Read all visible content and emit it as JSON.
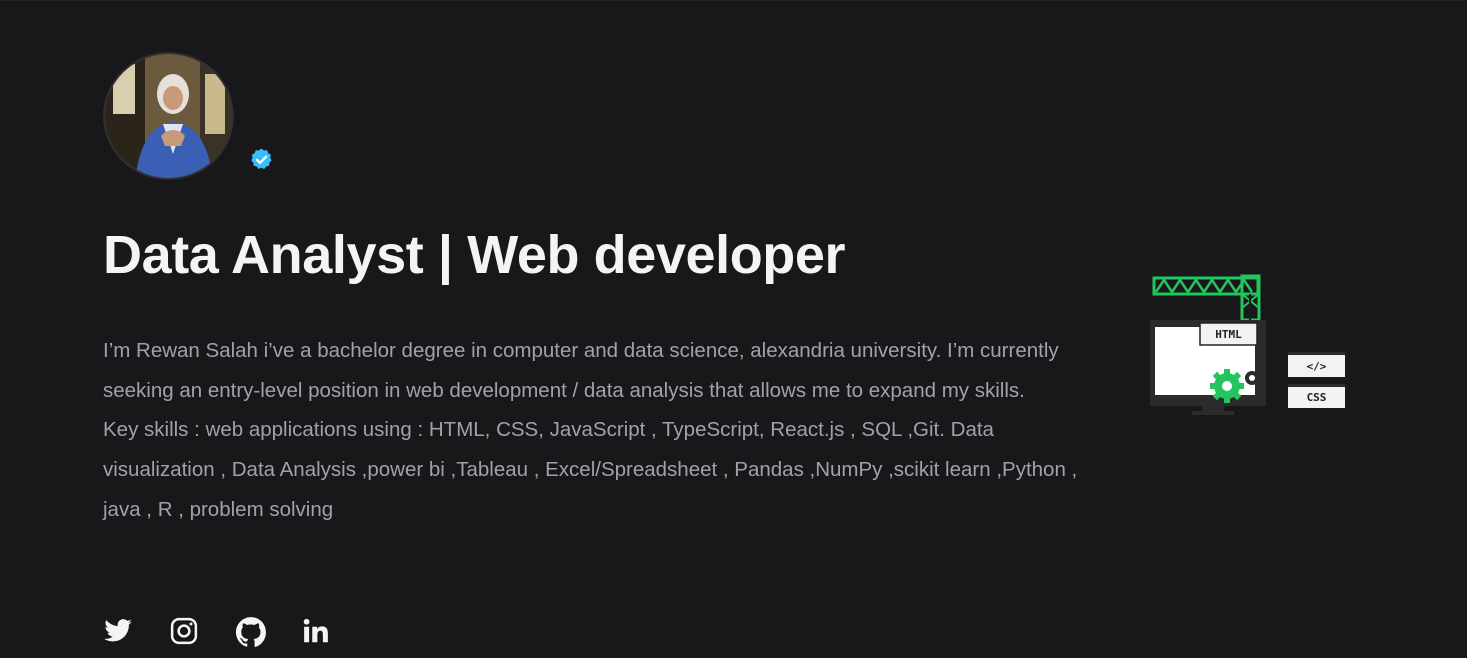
{
  "profile": {
    "avatar_alt": "Profile photo",
    "verified_badge": "verified-badge-icon"
  },
  "headline": "Data Analyst | Web developer",
  "bio": {
    "paragraph_1": "I’m Rewan Salah i’ve a bachelor degree in computer and data science, alexandria university. I’m currently seeking an entry-level position in web development / data analysis that allows me to expand my skills.",
    "paragraph_2": "Key skills : web applications using : HTML, CSS, JavaScript , TypeScript, React.js , SQL ,Git. Data visualization , Data Analysis ,power bi ,Tableau , Excel/Spreadsheet , Pandas ,NumPy ,scikit learn ,Python , java , R , problem solving"
  },
  "social": [
    {
      "name": "Twitter",
      "icon": "twitter-icon"
    },
    {
      "name": "Instagram",
      "icon": "instagram-icon"
    },
    {
      "name": "GitHub",
      "icon": "github-icon"
    },
    {
      "name": "LinkedIn",
      "icon": "linkedin-icon"
    }
  ],
  "illustration": {
    "html_tag": "HTML",
    "code_tag": "</>",
    "css_tag": "CSS"
  },
  "colors": {
    "background": "#18181b",
    "headline": "#f4f4f5",
    "body_text": "#a1a1aa",
    "verified": "#38bdf8",
    "accent_green": "#22c55e"
  }
}
